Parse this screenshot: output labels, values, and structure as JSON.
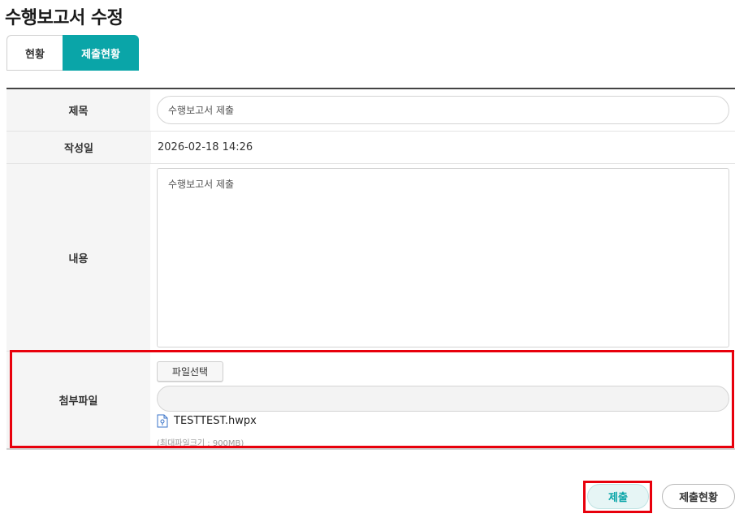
{
  "page": {
    "title": "수행보고서 수정"
  },
  "tabs": [
    {
      "label": "현황",
      "active": false
    },
    {
      "label": "제출현황",
      "active": true
    }
  ],
  "form": {
    "title_label": "제목",
    "title_value": "수행보고서 제출",
    "date_label": "작성일",
    "date_value": "2026-02-18 14:26",
    "content_label": "내용",
    "content_value": "수행보고서 제출",
    "attach_label": "첨부파일",
    "file_button": "파일선택",
    "file_path": "",
    "file_name": "TESTTEST.hwpx",
    "file_hint": "(최대파일크기 : 900MB)"
  },
  "actions": {
    "submit": "제출",
    "submit_status": "제출현황"
  },
  "colors": {
    "accent": "#0aa5a8",
    "highlight": "#e8000c"
  },
  "icons": {
    "file": "hwp-file-icon"
  }
}
